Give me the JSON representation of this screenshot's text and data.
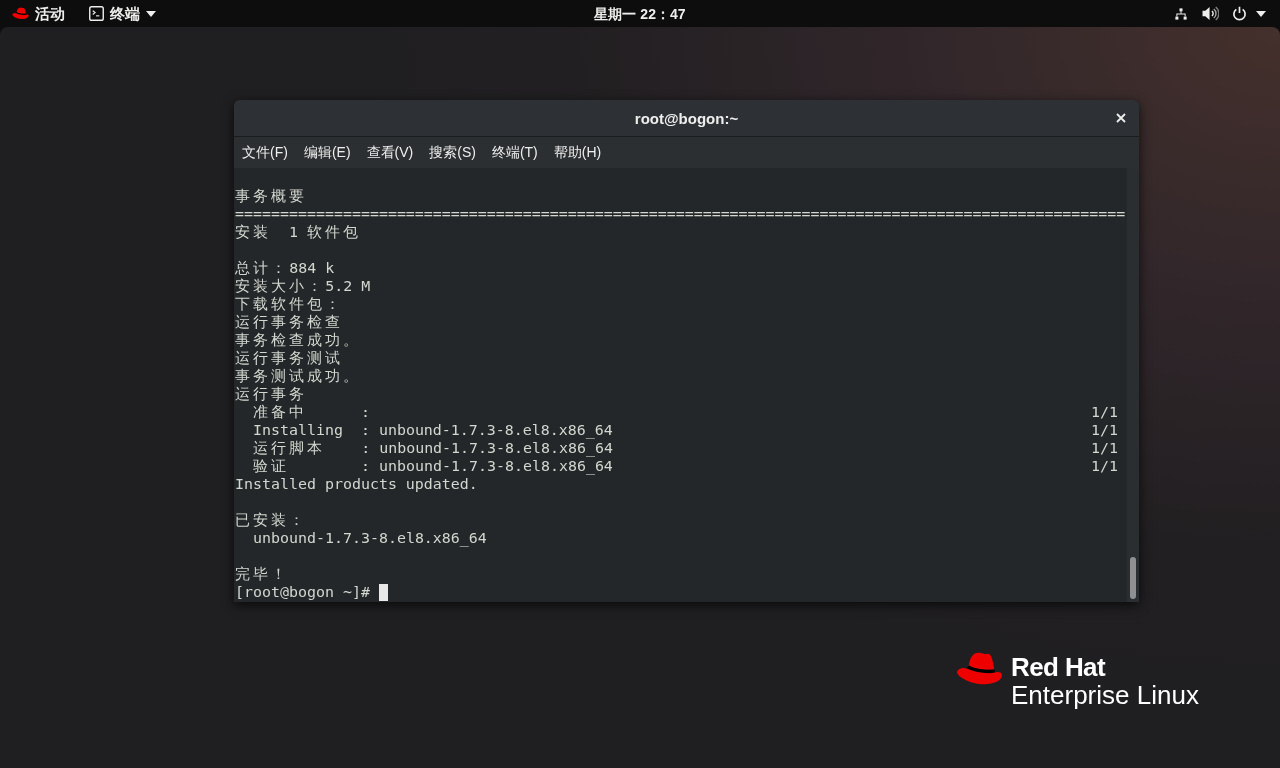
{
  "top_bar": {
    "activities": "活动",
    "app_menu": "终端",
    "clock": "星期一 22：47"
  },
  "window": {
    "title": "root@bogon:~",
    "menu": [
      "文件(F)",
      "编辑(E)",
      "查看(V)",
      "搜索(S)",
      "终端(T)",
      "帮助(H)"
    ],
    "terminal": {
      "blocks": [
        [
          {
            "text": "事务概要"
          },
          {
            "text": "==================================================================================================="
          },
          {
            "text": "安装  1 软件包"
          }
        ],
        [
          {
            "text": "总计：884 k"
          },
          {
            "text": "安装大小：5.2 M"
          },
          {
            "text": "下载软件包："
          },
          {
            "text": "运行事务检查"
          },
          {
            "text": "事务检查成功。"
          },
          {
            "text": "运行事务测试"
          },
          {
            "text": "事务测试成功。"
          },
          {
            "text": "运行事务",
            "children": [
              {
                "text": "准备中      :",
                "count": "1/1"
              },
              {
                "text": "Installing  : unbound-1.7.3-8.el8.x86_64",
                "count": "1/1"
              },
              {
                "text": "运行脚本    : unbound-1.7.3-8.el8.x86_64",
                "count": "1/1"
              },
              {
                "text": "验证        : unbound-1.7.3-8.el8.x86_64",
                "count": "1/1"
              }
            ]
          },
          {
            "text": "Installed products updated."
          }
        ],
        [
          {
            "text": "已安装：",
            "children": [
              {
                "text": "unbound-1.7.3-8.el8.x86_64"
              }
            ]
          }
        ],
        [
          {
            "text": "完毕！"
          }
        ]
      ],
      "prompt": "[root@bogon ~]#",
      "cursor": true
    }
  },
  "logo": {
    "line_1": "Red Hat",
    "line_2": "Enterprise Linux"
  }
}
